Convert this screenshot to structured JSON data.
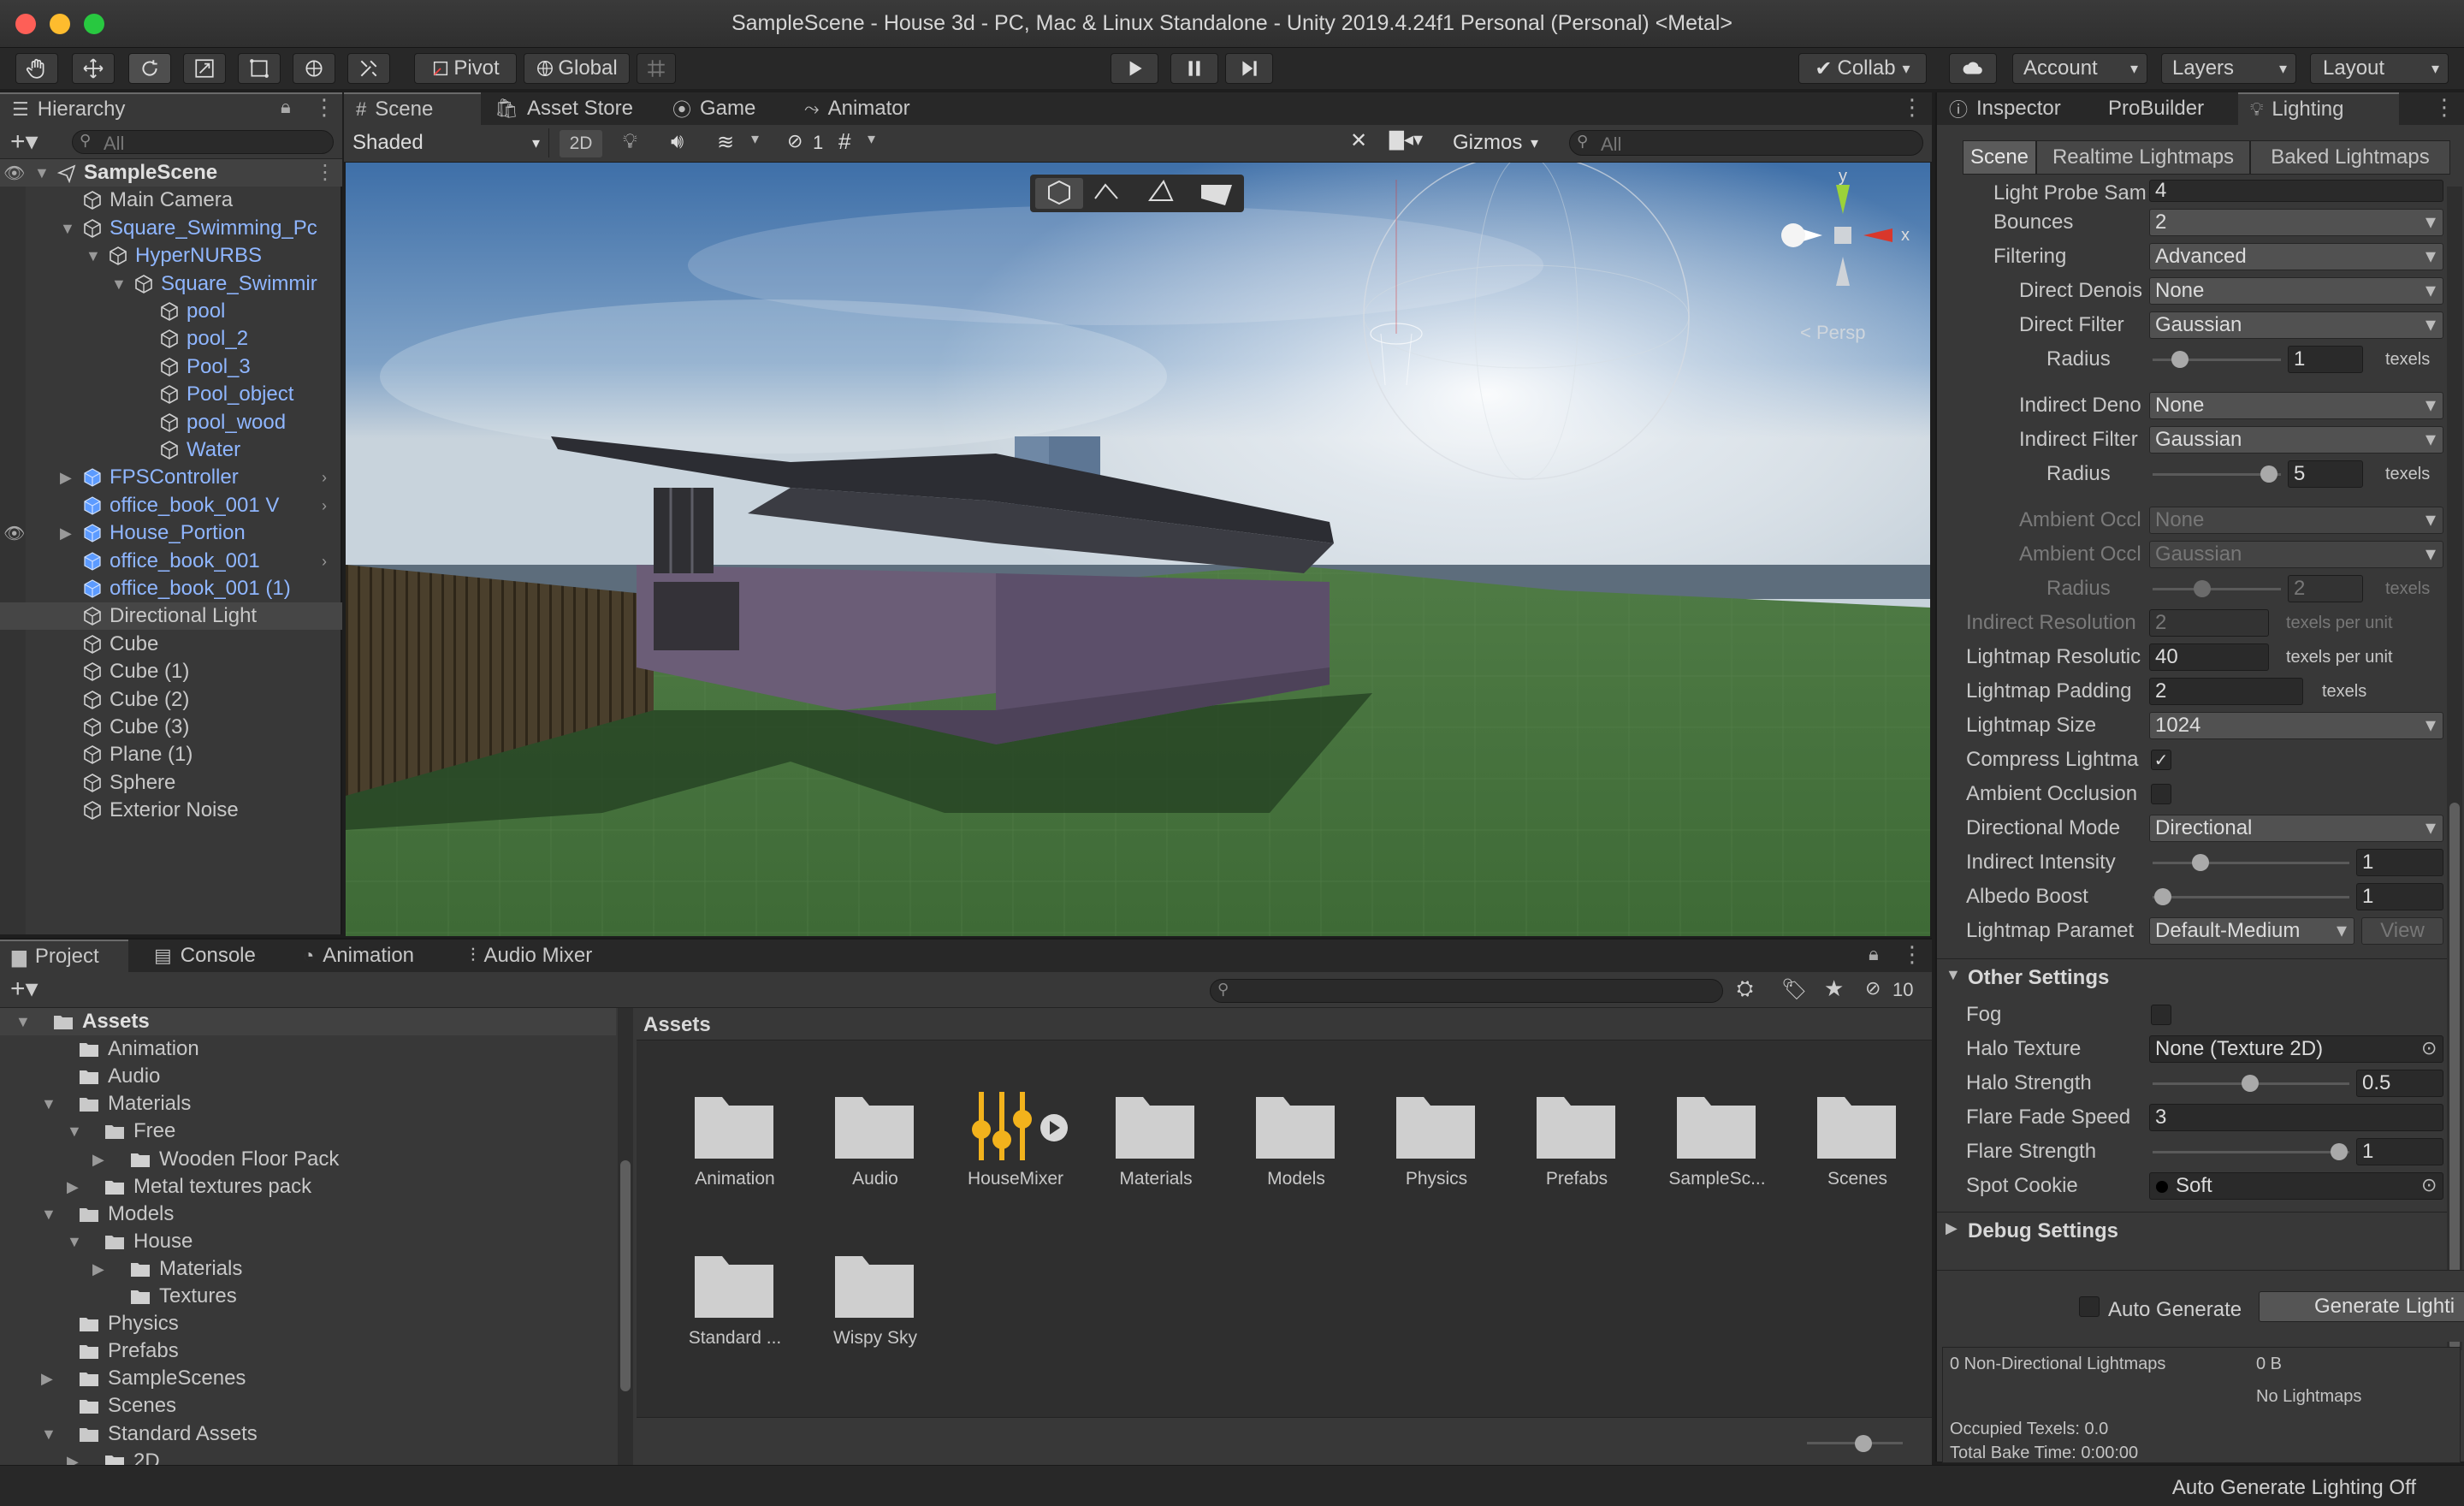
{
  "window": {
    "title": "SampleScene - House 3d - PC, Mac & Linux Standalone - Unity 2019.4.24f1 Personal (Personal) <Metal>"
  },
  "toolbar": {
    "pivot": "Pivot",
    "global": "Global",
    "collab": "Collab",
    "account": "Account",
    "layers": "Layers",
    "layout": "Layout"
  },
  "hierarchy": {
    "tab": "Hierarchy",
    "search_placeholder": "All",
    "items": [
      {
        "label": "SampleScene"
      },
      {
        "label": "Main Camera"
      },
      {
        "label": "Square_Swimming_Pc"
      },
      {
        "label": "HyperNURBS"
      },
      {
        "label": "Square_Swimmir"
      },
      {
        "label": "pool"
      },
      {
        "label": "pool_2"
      },
      {
        "label": "Pool_3"
      },
      {
        "label": "Pool_object"
      },
      {
        "label": "pool_wood"
      },
      {
        "label": "Water"
      },
      {
        "label": "FPSController"
      },
      {
        "label": "office_book_001 V"
      },
      {
        "label": "House_Portion"
      },
      {
        "label": "office_book_001"
      },
      {
        "label": "office_book_001 (1)"
      },
      {
        "label": "Directional Light"
      },
      {
        "label": "Cube"
      },
      {
        "label": "Cube (1)"
      },
      {
        "label": "Cube (2)"
      },
      {
        "label": "Cube (3)"
      },
      {
        "label": "Plane (1)"
      },
      {
        "label": "Sphere"
      },
      {
        "label": "Exterior Noise"
      }
    ]
  },
  "scene": {
    "tabs": [
      "Scene",
      "Asset Store",
      "Game",
      "Animator"
    ],
    "shading": "Shaded",
    "mode_2d": "2D",
    "hidden_count": "1",
    "gizmos": "Gizmos",
    "search_placeholder": "All",
    "axis_y": "y",
    "axis_x": "x",
    "persp": "Persp"
  },
  "inspector": {
    "tabs": [
      "Inspector",
      "ProBuilder",
      "Lighting"
    ],
    "subtabs": [
      "Scene",
      "Realtime Lightmaps",
      "Baked Lightmaps"
    ],
    "rows": {
      "light_probe": {
        "label": "Light Probe Sam",
        "value": "4"
      },
      "bounces": {
        "label": "Bounces",
        "value": "2"
      },
      "filtering": {
        "label": "Filtering",
        "value": "Advanced"
      },
      "direct_denoiser": {
        "label": "Direct Denois",
        "value": "None"
      },
      "direct_filter": {
        "label": "Direct Filter",
        "value": "Gaussian"
      },
      "radius1": {
        "label": "Radius",
        "value": "1",
        "unit": "texels"
      },
      "indirect_denoiser": {
        "label": "Indirect Deno",
        "value": "None"
      },
      "indirect_filter": {
        "label": "Indirect Filter",
        "value": "Gaussian"
      },
      "radius2": {
        "label": "Radius",
        "value": "5",
        "unit": "texels"
      },
      "ambient_denoiser": {
        "label": "Ambient Occl",
        "value": "None"
      },
      "ambient_filter": {
        "label": "Ambient Occl",
        "value": "Gaussian"
      },
      "radius3": {
        "label": "Radius",
        "value": "2",
        "unit": "texels"
      },
      "indirect_resolution": {
        "label": "Indirect Resolution",
        "value": "2",
        "unit": "texels per unit"
      },
      "lightmap_resolution": {
        "label": "Lightmap Resolutic",
        "value": "40",
        "unit": "texels per unit"
      },
      "lightmap_padding": {
        "label": "Lightmap Padding",
        "value": "2",
        "unit": "texels"
      },
      "lightmap_size": {
        "label": "Lightmap Size",
        "value": "1024"
      },
      "compress": {
        "label": "Compress Lightma"
      },
      "ambient_occlusion": {
        "label": "Ambient Occlusion"
      },
      "directional_mode": {
        "label": "Directional Mode",
        "value": "Directional"
      },
      "indirect_intensity": {
        "label": "Indirect Intensity",
        "value": "1"
      },
      "albedo_boost": {
        "label": "Albedo Boost",
        "value": "1"
      },
      "lightmap_params": {
        "label": "Lightmap Paramet",
        "value": "Default-Medium",
        "button": "View"
      }
    },
    "other_settings": {
      "title": "Other Settings",
      "fog": "Fog",
      "halo_texture": {
        "label": "Halo Texture",
        "value": "None (Texture 2D)"
      },
      "halo_strength": {
        "label": "Halo Strength",
        "value": "0.5"
      },
      "flare_fade": {
        "label": "Flare Fade Speed",
        "value": "3"
      },
      "flare_strength": {
        "label": "Flare Strength",
        "value": "1"
      },
      "spot_cookie": {
        "label": "Spot Cookie",
        "value": "Soft"
      }
    },
    "debug_settings": "Debug Settings",
    "auto_generate": "Auto Generate",
    "generate_button": "Generate Lighti",
    "stats": {
      "non_directional": "0 Non-Directional Lightmaps",
      "size": "0 B",
      "no_lightmaps": "No Lightmaps",
      "occupied": "Occupied Texels: 0.0",
      "bake_time": "Total Bake Time: 0:00:00"
    }
  },
  "project": {
    "tabs": [
      "Project",
      "Console",
      "Animation",
      "Audio Mixer"
    ],
    "hidden_count": "10",
    "tree": [
      {
        "label": "Assets"
      },
      {
        "label": "Animation"
      },
      {
        "label": "Audio"
      },
      {
        "label": "Materials"
      },
      {
        "label": "Free"
      },
      {
        "label": "Wooden Floor Pack"
      },
      {
        "label": "Metal textures pack"
      },
      {
        "label": "Models"
      },
      {
        "label": "House"
      },
      {
        "label": "Materials"
      },
      {
        "label": "Textures"
      },
      {
        "label": "Physics"
      },
      {
        "label": "Prefabs"
      },
      {
        "label": "SampleScenes"
      },
      {
        "label": "Scenes"
      },
      {
        "label": "Standard Assets"
      },
      {
        "label": "2D"
      }
    ],
    "breadcrumb": "Assets",
    "assets": [
      {
        "label": "Animation"
      },
      {
        "label": "Audio"
      },
      {
        "label": "HouseMixer"
      },
      {
        "label": "Materials"
      },
      {
        "label": "Models"
      },
      {
        "label": "Physics"
      },
      {
        "label": "Prefabs"
      },
      {
        "label": "SampleSc..."
      },
      {
        "label": "Scenes"
      },
      {
        "label": "Standard ..."
      },
      {
        "label": "Wispy Sky"
      }
    ]
  },
  "status": {
    "text": "Auto Generate Lighting Off"
  },
  "colors": {
    "accent_blue": "#8fb6ff",
    "mixer_yellow": "#f2b21c",
    "panel": "#383838",
    "toolbar": "#282828"
  }
}
